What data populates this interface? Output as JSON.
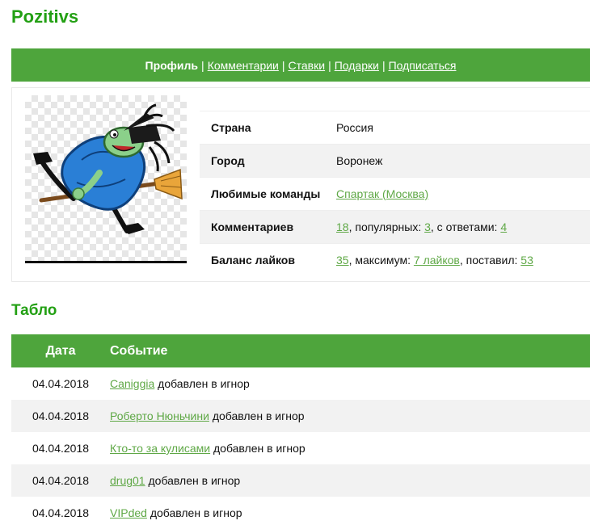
{
  "page": {
    "title": "Pozitivs"
  },
  "nav": {
    "active": "Профиль",
    "links": [
      "Комментарии",
      "Ставки",
      "Подарки",
      "Подписаться"
    ],
    "separator": "|"
  },
  "profile": {
    "avatar_icon": "witch-on-broom-icon",
    "rows": {
      "country": {
        "label": "Страна",
        "value": "Россия"
      },
      "city": {
        "label": "Город",
        "value": "Воронеж"
      },
      "teams": {
        "label": "Любимые команды",
        "value": "Спартак (Москва)"
      },
      "comments": {
        "label": "Комментариев",
        "count": "18",
        "popular_label": ", популярных: ",
        "popular": "3",
        "replies_label": ", с ответами: ",
        "replies": "4"
      },
      "likes": {
        "label": "Баланс лайков",
        "balance": "35",
        "max_label": ", максимум: ",
        "max": "7 лайков",
        "given_label": ", поставил: ",
        "given": "53"
      }
    }
  },
  "tablo": {
    "title": "Табло",
    "headers": {
      "date": "Дата",
      "event": "Событие"
    },
    "rows": [
      {
        "date": "04.04.2018",
        "user": "Caniggia",
        "action": " добавлен в игнор"
      },
      {
        "date": "04.04.2018",
        "user": "Роберто Нюньчини",
        "action": " добавлен в игнор"
      },
      {
        "date": "04.04.2018",
        "user": "Кто-то за кулисами",
        "action": " добавлен в игнор"
      },
      {
        "date": "04.04.2018",
        "user": "drug01",
        "action": " добавлен в игнор"
      },
      {
        "date": "04.04.2018",
        "user": "VIPded",
        "action": " добавлен в игнор"
      }
    ]
  },
  "colors": {
    "brand_green": "#23a014",
    "bar_green": "#4ea53c",
    "link_green": "#5fa846",
    "zebra": "#f2f2f2"
  }
}
